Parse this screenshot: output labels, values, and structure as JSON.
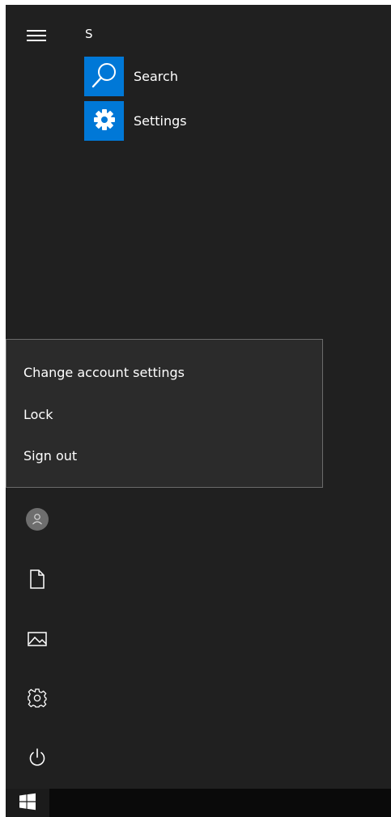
{
  "start_menu": {
    "group_header": "S",
    "apps": [
      {
        "label": "Search",
        "icon": "search-icon"
      },
      {
        "label": "Settings",
        "icon": "gear-icon"
      }
    ]
  },
  "account_menu": {
    "items": [
      {
        "label": "Change account settings"
      },
      {
        "label": "Lock"
      },
      {
        "label": "Sign out"
      }
    ]
  },
  "left_rail": {
    "icons": [
      "user-avatar-icon",
      "documents-icon",
      "pictures-icon",
      "settings-icon",
      "power-icon"
    ]
  },
  "taskbar": {
    "start_icon": "windows-logo-icon"
  },
  "colors": {
    "menu_background": "#202020",
    "flyout_background": "#2b2b2b",
    "tile_accent": "#0078d7",
    "taskbar": "#0a0a0a",
    "text": "#ffffff"
  }
}
